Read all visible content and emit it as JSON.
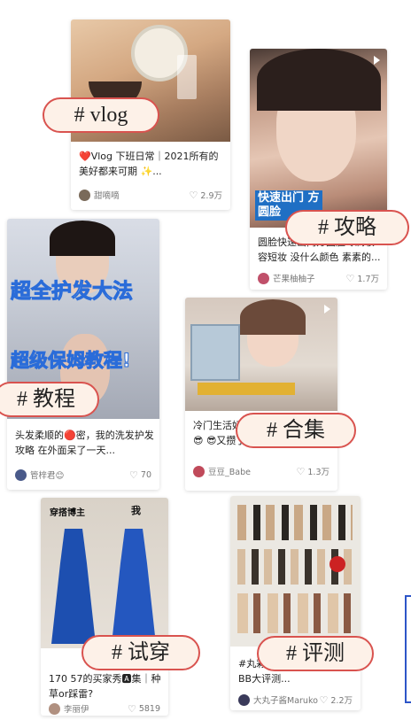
{
  "cards": [
    {
      "title": "❤️Vlog 下班日常｜2021所有的美好都来可期 ✨...",
      "author": "甜嘀嘀",
      "likes": "2.9万",
      "tag": "# vlog",
      "overlay": "",
      "avatar_color": "#7a6a5a"
    },
    {
      "title": "圆脸快速出门方圆脸专属妆容短妆 没什么颜色 素素的...",
      "author": "芒果柚柚子",
      "likes": "1.7万",
      "tag": "# 攻略",
      "overlay": "快速出门 方圆脸",
      "avatar_color": "#c0506a"
    },
    {
      "title": "头发柔顺的🔴密，我的洗发护发攻略 在外面呆了一天...",
      "author": "管梓君😊",
      "likes": "70",
      "tag": "# 教程",
      "overlay": "超全护发大法",
      "overlay2": "超级保姆教程!",
      "avatar_color": "#4a5a8a"
    },
    {
      "title": "冷门生活好物分享 致女孩必备😎 😎又攒了...",
      "author": "豆豆_Babe",
      "likes": "1.3万",
      "tag": "# 合集",
      "overlay": "",
      "avatar_color": "#c04a5a"
    },
    {
      "title": "170 57的买家秀🅰集｜种草or踩雷?",
      "author": "李丽伊",
      "likes": "5819",
      "tag": "# 试穿",
      "overlay": "穿搭博主",
      "overlay2": "我",
      "avatar_color": "#b09080"
    },
    {
      "title": "#丸彩妆 液/粉底霜/气垫BB大评测...",
      "author": "大丸子酱Maruko",
      "likes": "2.2万",
      "tag": "# 评测",
      "overlay": "",
      "avatar_color": "#3a3a5a"
    }
  ],
  "colors": {
    "tag_border": "#d9534f",
    "tag_bg": "#fdf1e8",
    "frame_blue": "#2d55c8"
  }
}
